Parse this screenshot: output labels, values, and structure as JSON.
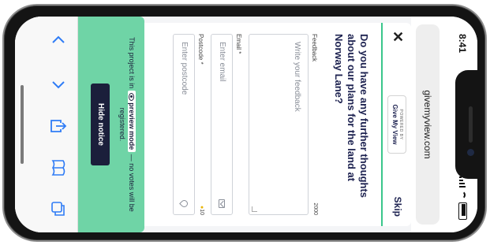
{
  "status": {
    "time": "8:41"
  },
  "browser": {
    "url": "givemyview.com"
  },
  "modal": {
    "close_symbol": "✕",
    "powered_small": "POWERED BY",
    "powered_brand": "Give My View",
    "skip_label": "Skip",
    "question": "Do you have any further thoughts about our plans for the land at Norway Lane?",
    "feedback": {
      "label": "Feedback",
      "count": "2000",
      "placeholder": "Write your feedback"
    },
    "email": {
      "label": "Email *",
      "placeholder": "Enter email"
    },
    "postcode": {
      "label": "Postcode *",
      "points": "10",
      "placeholder": "Enter postcode"
    }
  },
  "notice": {
    "text_before": "This project is in",
    "preview_label": "preview mode",
    "text_after": "— no votes will be registered.",
    "hide_label": "Hide notice"
  },
  "toolbar": {
    "items": [
      "back-icon",
      "forward-icon",
      "share-icon",
      "bookmarks-icon",
      "tabs-icon"
    ]
  },
  "colors": {
    "accent": "#3ac68b",
    "notice_bg": "#6fd4a6",
    "navy": "#1b1f3b",
    "toolbar_icon": "#2f7cf6"
  }
}
